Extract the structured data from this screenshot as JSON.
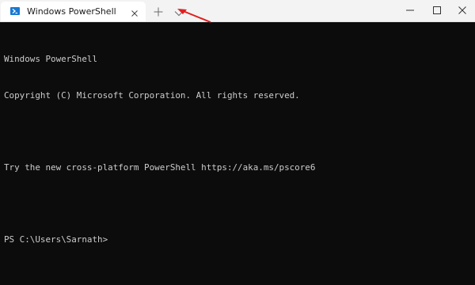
{
  "tab": {
    "title": "Windows PowerShell",
    "icon": "powershell-icon",
    "close_icon": "close-icon"
  },
  "toolbar": {
    "new_tab_icon": "plus-icon",
    "dropdown_icon": "chevron-down-icon"
  },
  "window_controls": {
    "minimize_icon": "minimize-icon",
    "maximize_icon": "maximize-icon",
    "close_icon": "close-icon"
  },
  "annotation": {
    "arrow_color": "#e02020"
  },
  "terminal": {
    "line1": "Windows PowerShell",
    "line2": "Copyright (C) Microsoft Corporation. All rights reserved.",
    "line3": "",
    "line4": "Try the new cross-platform PowerShell https://aka.ms/pscore6",
    "line5": "",
    "prompt": "PS C:\\Users\\Sarnath>"
  },
  "colors": {
    "terminal_bg": "#0c0c0c",
    "terminal_fg": "#cccccc",
    "titlebar_bg": "#f3f3f3",
    "tab_bg": "#ffffff",
    "ps_blue": "#1979d2"
  }
}
